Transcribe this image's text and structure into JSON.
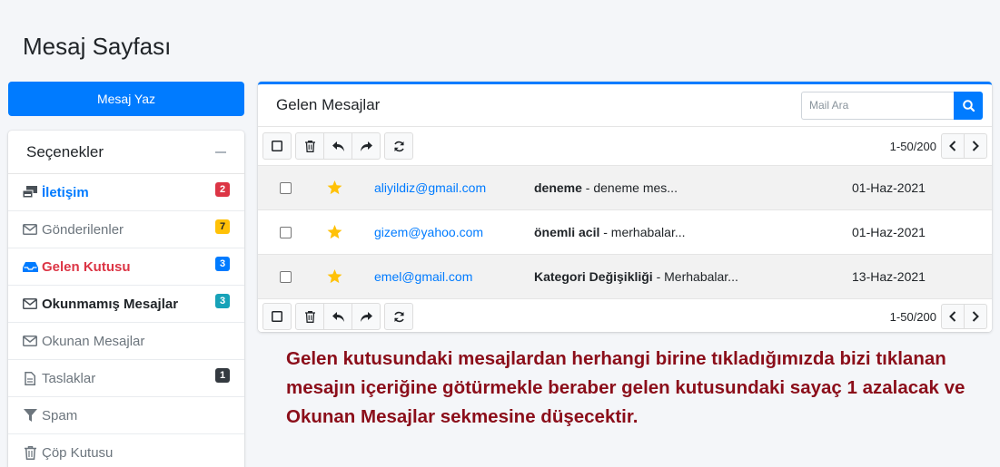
{
  "page": {
    "title": "Mesaj Sayfası"
  },
  "compose": {
    "label": "Mesaj Yaz"
  },
  "options": {
    "title": "Seçenekler",
    "items": [
      {
        "label": "İletişim",
        "icon": "inbox-multiple-icon",
        "badge": "2",
        "badge_color": "#dc3545"
      },
      {
        "label": "Gönderilenler",
        "icon": "envelope-icon",
        "badge": "7",
        "badge_color": "#ffc107"
      },
      {
        "label": "Gelen Kutusu",
        "icon": "inbox-icon",
        "badge": "3",
        "badge_color": "#007bff"
      },
      {
        "label": "Okunmamış Mesajlar",
        "icon": "envelope-icon",
        "badge": "3",
        "badge_color": "#17a2b8"
      },
      {
        "label": "Okunan Mesajlar",
        "icon": "envelope-icon",
        "badge": "",
        "badge_color": ""
      },
      {
        "label": "Taslaklar",
        "icon": "file-icon",
        "badge": "1",
        "badge_color": "#343a40"
      },
      {
        "label": "Spam",
        "icon": "filter-icon",
        "badge": "",
        "badge_color": ""
      },
      {
        "label": "Çöp Kutusu",
        "icon": "trash-icon",
        "badge": "",
        "badge_color": ""
      }
    ]
  },
  "mailbox": {
    "title": "Gelen Mesajlar",
    "search_placeholder": "Mail Ara",
    "pager": "1-50/200",
    "rows": [
      {
        "sender": "aliyildiz@gmail.com",
        "subject": "deneme",
        "preview": " - deneme mes...",
        "date": "01-Haz-2021"
      },
      {
        "sender": "gizem@yahoo.com",
        "subject": "önemli acil",
        "preview": " - merhabalar...",
        "date": "01-Haz-2021"
      },
      {
        "sender": "emel@gmail.com",
        "subject": "Kategori Değişikliği",
        "preview": " - Merhabalar...",
        "date": "13-Haz-2021"
      }
    ]
  },
  "annotation": "Gelen kutusundaki mesajlardan herhangi birine tıkladığımızda bizi tıklanan mesajın içeriğine götürmekle beraber gelen kutusundaki sayaç 1 azalacak ve Okunan Mesajlar sekmesine düşecektir.",
  "colors": {
    "accent": "#007bff",
    "star": "#ffc107",
    "annotation": "#8b0e1a"
  }
}
